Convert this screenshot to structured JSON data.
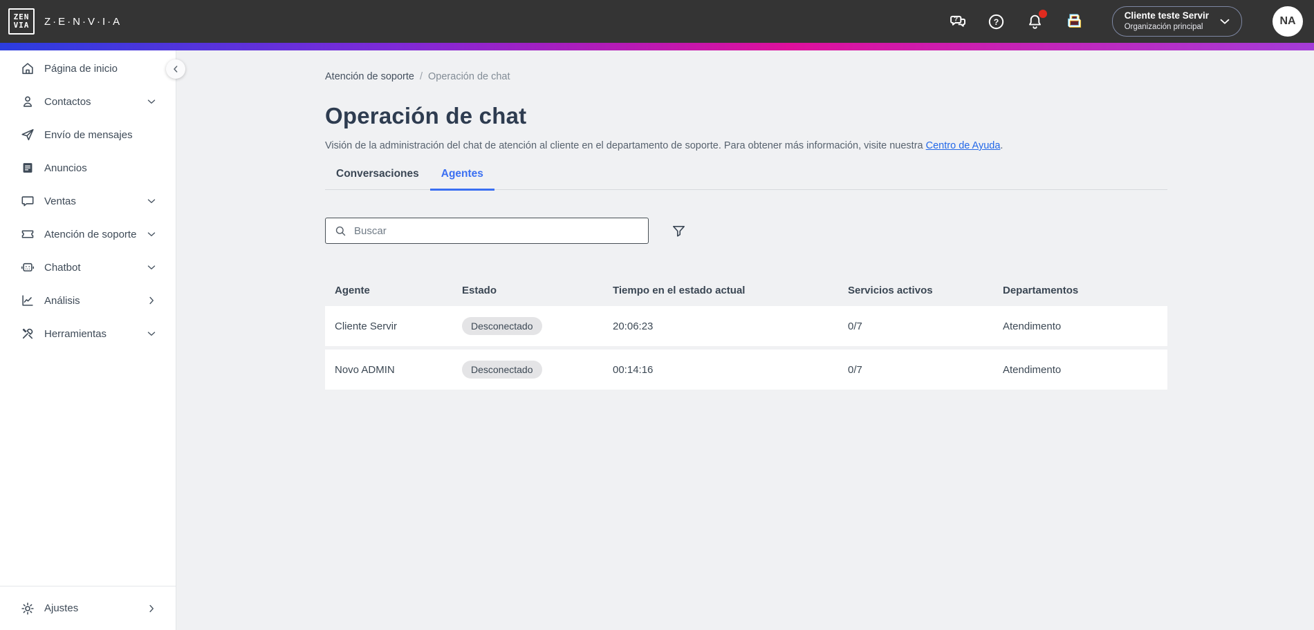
{
  "topbar": {
    "logo_line1": "ZEN",
    "logo_line2": "VIA",
    "brand": "Z·E·N·V·I·A",
    "icons": [
      "chat-feedback-icon",
      "help-icon",
      "notifications-bell-icon",
      "apps-printer-icon"
    ],
    "account": {
      "client": "Cliente teste Servir",
      "org": "Organización principal"
    },
    "avatar_initials": "NA"
  },
  "sidebar": {
    "items": [
      {
        "label": "Página de inicio",
        "icon": "home-icon",
        "chevron": "none"
      },
      {
        "label": "Contactos",
        "icon": "contacts-icon",
        "chevron": "down"
      },
      {
        "label": "Envío de mensajes",
        "icon": "send-icon",
        "chevron": "none"
      },
      {
        "label": "Anuncios",
        "icon": "announcements-icon",
        "chevron": "none"
      },
      {
        "label": "Ventas",
        "icon": "sales-bubble-icon",
        "chevron": "down"
      },
      {
        "label": "Atención de soporte",
        "icon": "support-ticket-icon",
        "chevron": "down"
      },
      {
        "label": "Chatbot",
        "icon": "chatbot-robot-icon",
        "chevron": "down"
      },
      {
        "label": "Análisis",
        "icon": "analytics-chart-icon",
        "chevron": "right"
      },
      {
        "label": "Herramientas",
        "icon": "tools-icon",
        "chevron": "down"
      }
    ],
    "footer_item": {
      "label": "Ajustes",
      "icon": "settings-gear-icon",
      "chevron": "right"
    }
  },
  "breadcrumb": {
    "parent": "Atención de soporte",
    "separator": "/",
    "current": "Operación de chat"
  },
  "page": {
    "title": "Operación de chat",
    "description": "Visión de la administración del chat de atención al cliente en el departamento de soporte. Para obtener más información, visite nuestra ",
    "description_link": "Centro de Ayuda",
    "description_suffix": "."
  },
  "tabs": [
    {
      "label": "Conversaciones",
      "active": false
    },
    {
      "label": "Agentes",
      "active": true
    }
  ],
  "search": {
    "placeholder": "Buscar",
    "filter_icon": "funnel-filter-icon"
  },
  "table": {
    "columns": [
      "Agente",
      "Estado",
      "Tiempo en el estado actual",
      "Servicios activos",
      "Departamentos"
    ],
    "rows": [
      {
        "agent": "Cliente Servir",
        "status": "Desconectado",
        "time": "20:06:23",
        "services": "0/7",
        "departments": "Atendimento"
      },
      {
        "agent": "Novo ADMIN",
        "status": "Desconectado",
        "time": "00:14:16",
        "services": "0/7",
        "departments": "Atendimento"
      }
    ]
  },
  "colors": {
    "topbar_bg": "#343434",
    "gradient": [
      "#2b3ddf",
      "#7e2ad8",
      "#de109c",
      "#a43cd8"
    ],
    "accent_blue": "#3a6ff2",
    "link_blue": "#2368e8",
    "notification_red": "#e02b1f",
    "badge_gray": "#e4e4e6"
  }
}
